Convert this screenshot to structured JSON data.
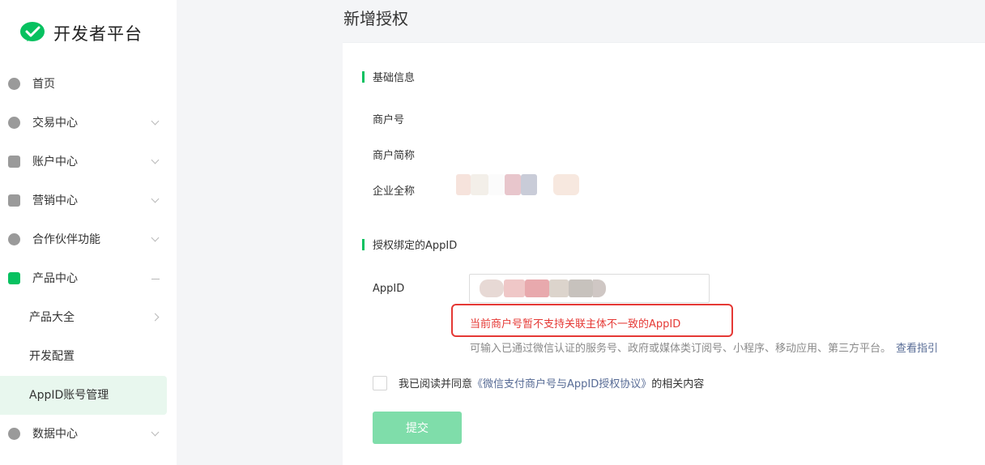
{
  "brand": {
    "name": "开发者平台",
    "accent": "#07c160"
  },
  "sidebar": {
    "items": [
      {
        "label": "首页",
        "icon": "home-icon",
        "trailing": ""
      },
      {
        "label": "交易中心",
        "icon": "exchange-icon",
        "trailing": "chevron-down-icon"
      },
      {
        "label": "账户中心",
        "icon": "account-icon",
        "trailing": "chevron-down-icon"
      },
      {
        "label": "营销中心",
        "icon": "coupon-icon",
        "trailing": "chevron-down-icon"
      },
      {
        "label": "合作伙伴功能",
        "icon": "partner-icon",
        "trailing": "chevron-down-icon"
      },
      {
        "label": "产品中心",
        "icon": "product-grid-icon",
        "trailing": "minus-icon",
        "expanded": true
      },
      {
        "label": "数据中心",
        "icon": "chart-pie-icon",
        "trailing": "chevron-down-icon"
      }
    ],
    "sub_items": [
      {
        "label": "产品大全",
        "trailing": "chevron-right-icon"
      },
      {
        "label": "开发配置"
      },
      {
        "label": "AppID账号管理",
        "active": true
      }
    ]
  },
  "page": {
    "title": "新增授权"
  },
  "form": {
    "section_basic": "基础信息",
    "merchant_no_label": "商户号",
    "merchant_short_label": "商户简称",
    "company_full_label": "企业全称",
    "section_appid": "授权绑定的AppID",
    "appid_label": "AppID",
    "error_text": "当前商户号暂不支持关联主体不一致的AppID",
    "hint_text": "可输入已通过微信认证的服务号、政府或媒体类订阅号、小程序、移动应用、第三方平台。",
    "hint_link": "查看指引",
    "agree_prefix": "我已阅读并同意",
    "agree_link": "《微信支付商户号与AppID授权协议》",
    "agree_suffix": "的相关内容",
    "submit_label": "提交"
  },
  "colors": {
    "error": "#e53935",
    "link": "#576b95",
    "submit_disabled": "#7fddaa",
    "active_bg": "#e8f7ee"
  }
}
